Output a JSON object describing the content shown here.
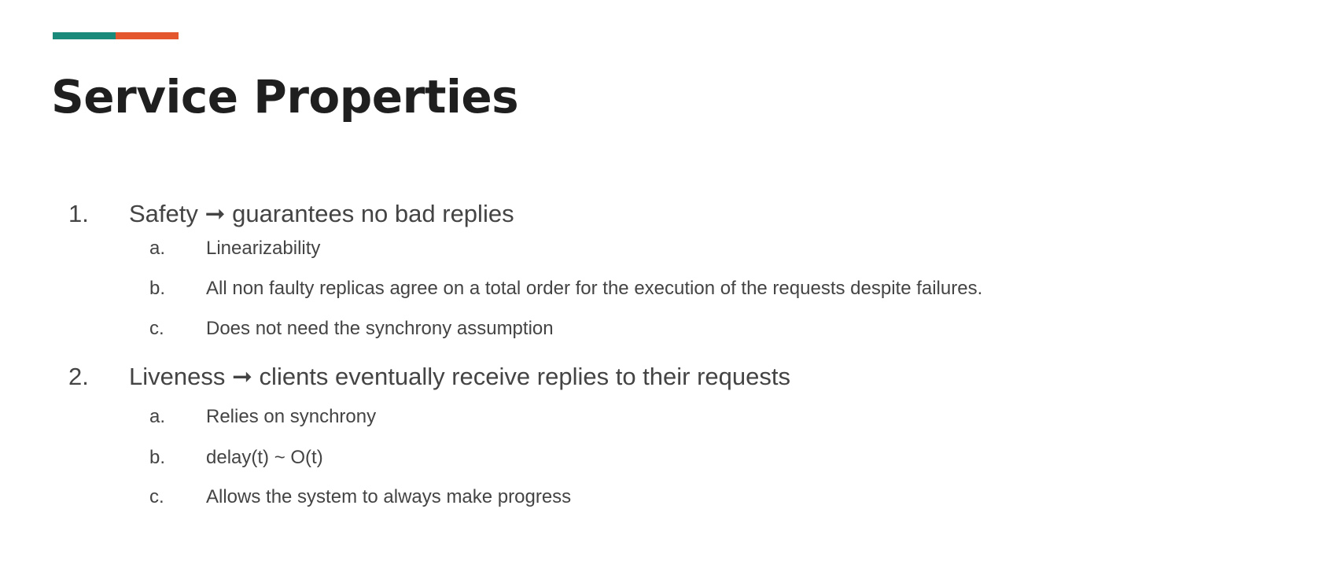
{
  "accent": {
    "colors": [
      "#1a8a7a",
      "#e4572e"
    ]
  },
  "slide": {
    "title": "Service Properties",
    "items": [
      {
        "marker": "1.",
        "text": "Safety ➞ guarantees no bad replies",
        "subitems": [
          {
            "marker": "a.",
            "text": "Linearizability"
          },
          {
            "marker": "b.",
            "text": "All non faulty replicas agree on a total order for the execution of the requests despite failures."
          },
          {
            "marker": "c.",
            "text": "Does not need the synchrony assumption"
          }
        ]
      },
      {
        "marker": "2.",
        "text": "Liveness ➞ clients eventually receive replies to their requests",
        "subitems": [
          {
            "marker": "a.",
            "text": "Relies on synchrony"
          },
          {
            "marker": "b.",
            "text": "delay(t) ~ O(t)"
          },
          {
            "marker": "c.",
            "text": "Allows the system to always make progress"
          }
        ]
      }
    ]
  }
}
